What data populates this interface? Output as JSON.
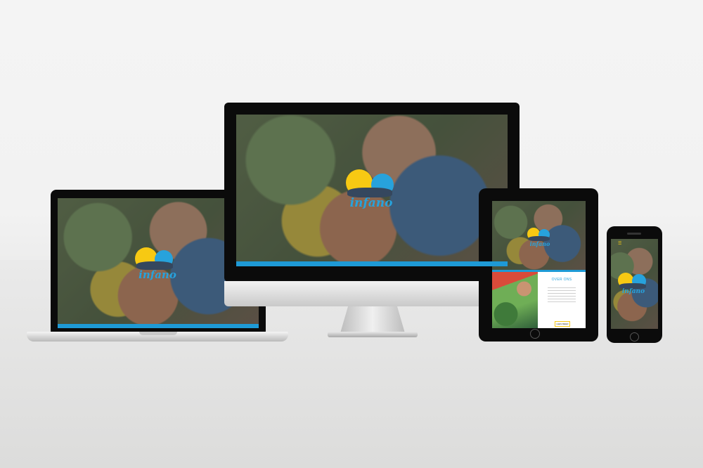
{
  "brand": {
    "logo_text": "infano",
    "colors": {
      "yellow": "#f7c913",
      "blue": "#27a2dc",
      "navy": "#35475e",
      "bar": "#1e9ad6"
    }
  },
  "tablet_section": {
    "heading": "OVER ONS",
    "button_label": "LEES MEER"
  },
  "devices": [
    "laptop",
    "desktop",
    "tablet",
    "phone"
  ]
}
